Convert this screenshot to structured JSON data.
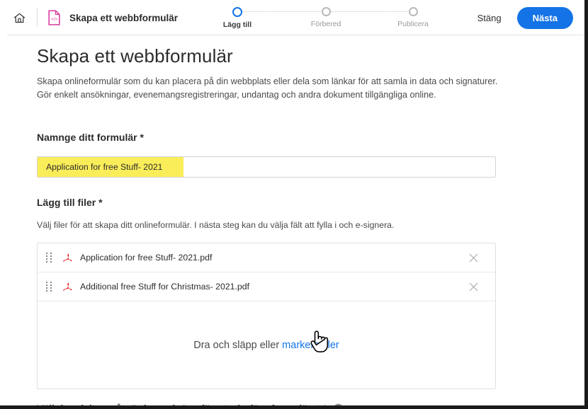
{
  "header": {
    "home_icon": "home-icon",
    "app_icon": "web-form-document-icon",
    "title": "Skapa ett webbformulär",
    "close_label": "Stäng",
    "next_label": "Nästa",
    "accent_color": "#1473e6",
    "app_icon_color": "#d83b9e"
  },
  "stepper": {
    "steps": [
      {
        "label": "Lägg till",
        "active": true
      },
      {
        "label": "Förbered",
        "active": false
      },
      {
        "label": "Publicera",
        "active": false
      }
    ]
  },
  "page": {
    "title": "Skapa ett webbformulär",
    "description_line1": "Skapa onlineformulär som du kan placera på din webbplats eller dela som länkar för att samla in data och signaturer.",
    "description_line2": "Gör enkelt ansökningar, evenemangsregistreringar, undantag och andra dokument tillgängliga online."
  },
  "name_section": {
    "label": "Namnge ditt formulär *",
    "value": "Application for free Stuff- 2021",
    "placeholder": "",
    "highlight_color": "#faed5a"
  },
  "files_section": {
    "label": "Lägg till filer *",
    "description": "Välj filer för att skapa ditt onlineformulär. I nästa steg kan du välja fält att fylla i och e-signera.",
    "files": [
      {
        "name": "Application for free Stuff- 2021.pdf",
        "icon": "pdf-icon",
        "remove_icon": "close-icon"
      },
      {
        "name": "Additional free Stuff for Christmas- 2021.pdf",
        "icon": "pdf-icon",
        "remove_icon": "close-icon"
      }
    ],
    "dropzone_text": "Dra och släpp eller ",
    "dropzone_link": "markera filer",
    "cursor_icon": "pointing-hand-cursor"
  },
  "action_section": {
    "label": "Välj den deltagaråtgärd som krävs för att slutföra formuläret *",
    "help_icon": "help-circle-icon"
  }
}
